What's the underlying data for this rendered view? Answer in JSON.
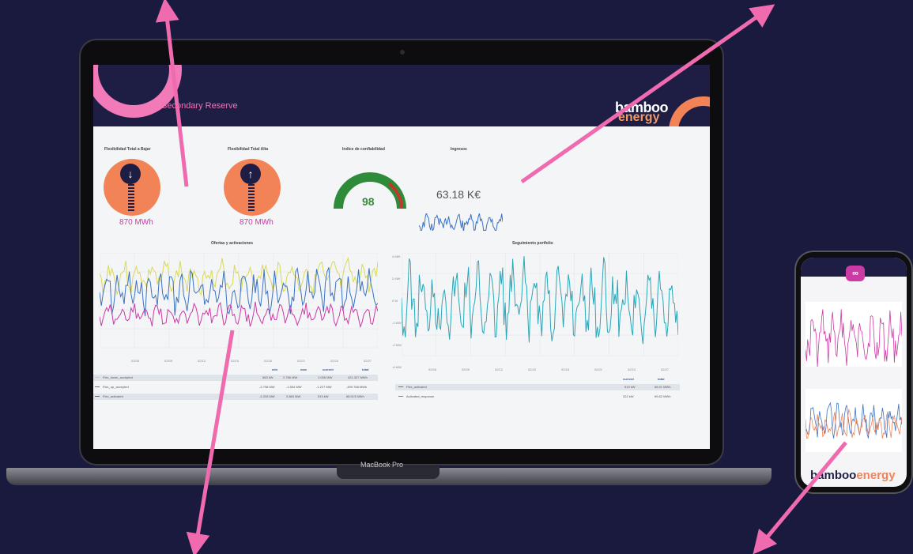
{
  "dashboard": {
    "title": "Secondary Reserve",
    "brand_line1": "bamboo",
    "brand_line2": "energy",
    "device_label": "MacBook Pro"
  },
  "panels": {
    "flex_down": {
      "title": "Flexibilidad Total a Bajar",
      "value": "870 MWh",
      "icon": "arrow-down-icon"
    },
    "flex_up": {
      "title": "Flexibilidad Total Alta",
      "value": "870 MWh",
      "icon": "arrow-up-icon"
    },
    "reliability": {
      "title": "Indice de confiabilidad",
      "value": "98"
    },
    "income": {
      "title": "Ingresos",
      "value": "63.18 K€"
    }
  },
  "offers_chart": {
    "title": "Ofertas y activaciones",
    "x_ticks": [
      "02/06",
      "02/09",
      "02/12",
      "02/15",
      "02/18",
      "02/21",
      "02/24",
      "02/27"
    ],
    "legend_headers": [
      "min",
      "max",
      "current",
      "total"
    ],
    "legend_rows": [
      {
        "name": "Flex_down_accepted",
        "min": "683 kW",
        "max": "2.786 MW",
        "current": "1.036 MW",
        "total": "421.327 MWh"
      },
      {
        "name": "Flex_up_accepted",
        "min": "-2.798 MW",
        "max": "-1.554 MW",
        "current": "-1.227 MW",
        "total": "-499.768 MWh"
      },
      {
        "name": "Flex_activated",
        "min": "-4.333 MW",
        "max": "2.869 MW",
        "current": "519 kW",
        "total": "68.913 MWh"
      }
    ]
  },
  "portfolio_chart": {
    "title": "Seguimiento portfolio",
    "y_ticks": [
      "4 MW",
      "2 MW",
      "0 W",
      "-2 MW",
      "-4 MW",
      "-6 MW"
    ],
    "x_ticks": [
      "02/06",
      "02/09",
      "02/12",
      "02/15",
      "02/18",
      "02/21",
      "02/24",
      "02/27"
    ],
    "legend_headers": [
      "current",
      "total"
    ],
    "legend_rows": [
      {
        "name": "Flex_activated",
        "current": "519 kW",
        "total": "68.91 MWh"
      },
      {
        "name": "Activated_response",
        "current": "322 kW",
        "total": "69.62 MWh"
      }
    ]
  },
  "phone": {
    "brand_line1": "bamboo",
    "brand_line2": "energy"
  },
  "colors": {
    "background": "#1a1a3e",
    "header": "#1e1e45",
    "accent_pink": "#f27ab8",
    "accent_orange": "#f18356",
    "series_yellow": "#d9d957",
    "series_magenta": "#cc3aa6",
    "series_blue": "#3b73c4",
    "series_teal": "#2aa7b8",
    "arrow": "#f06ab0"
  }
}
